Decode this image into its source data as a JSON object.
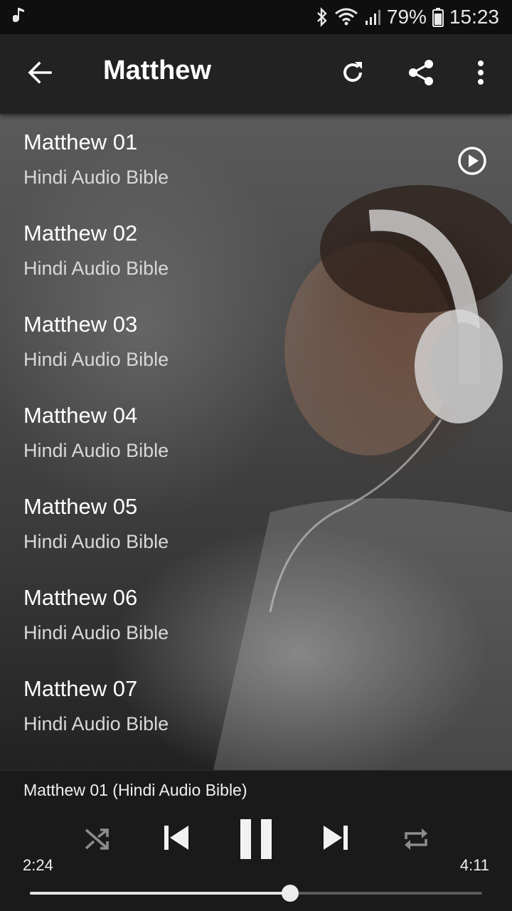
{
  "status_bar": {
    "battery": "79%",
    "time": "15:23",
    "icons": [
      "music-note-icon",
      "bluetooth-icon",
      "wifi-icon",
      "signal-icon",
      "battery-icon"
    ]
  },
  "app_bar": {
    "title": "Matthew",
    "icons": [
      "back-arrow-icon",
      "refresh-icon",
      "share-icon",
      "more-vert-icon"
    ]
  },
  "tracks": [
    {
      "title": "Matthew 01",
      "subtitle": "Hindi Audio Bible",
      "playing": true
    },
    {
      "title": "Matthew 02",
      "subtitle": "Hindi Audio Bible"
    },
    {
      "title": "Matthew 03",
      "subtitle": "Hindi Audio Bible"
    },
    {
      "title": "Matthew 04",
      "subtitle": "Hindi Audio Bible"
    },
    {
      "title": "Matthew 05",
      "subtitle": "Hindi Audio Bible"
    },
    {
      "title": "Matthew 06",
      "subtitle": "Hindi Audio Bible"
    },
    {
      "title": "Matthew 07",
      "subtitle": "Hindi Audio Bible"
    }
  ],
  "player": {
    "now_playing": "Matthew 01 (Hindi Audio Bible)",
    "elapsed": "2:24",
    "total": "4:11",
    "progress_fraction": 0.576,
    "icons": [
      "shuffle-icon",
      "skip-previous-icon",
      "pause-icon",
      "skip-next-icon",
      "repeat-icon"
    ]
  },
  "colors": {
    "app_bar": "#222222",
    "status_bar": "#0f0f0f",
    "player_bg": "#1a1a1a",
    "accent": "#ececec"
  }
}
